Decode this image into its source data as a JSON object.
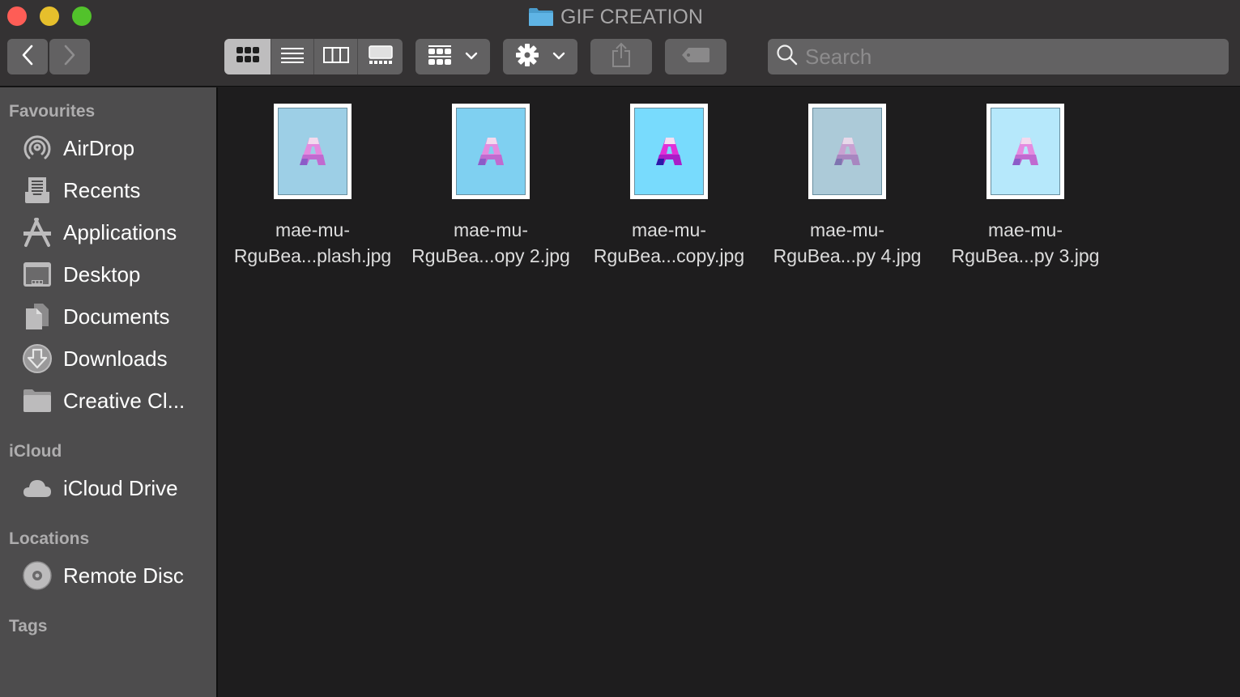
{
  "window": {
    "title": "GIF CREATION",
    "title_icon": "folder-icon",
    "folder_color": "#5fb4e5"
  },
  "toolbar": {
    "back_icon": "chevron-left-icon",
    "forward_icon": "chevron-right-icon",
    "view_modes": [
      {
        "name": "icon-view",
        "icon": "grid-icon",
        "active": true
      },
      {
        "name": "list-view",
        "icon": "list-icon",
        "active": false
      },
      {
        "name": "column-view",
        "icon": "columns-icon",
        "active": false
      },
      {
        "name": "gallery-view",
        "icon": "gallery-icon",
        "active": false
      }
    ],
    "group_icon": "group-icon",
    "action_icon": "gear-icon",
    "share_icon": "share-icon",
    "tag_icon": "tag-icon"
  },
  "search": {
    "placeholder": "Search",
    "value": ""
  },
  "sidebar": {
    "sections": [
      {
        "label": "Favourites",
        "items": [
          {
            "label": "AirDrop",
            "icon": "airdrop-icon"
          },
          {
            "label": "Recents",
            "icon": "recents-icon"
          },
          {
            "label": "Applications",
            "icon": "applications-icon"
          },
          {
            "label": "Desktop",
            "icon": "desktop-icon"
          },
          {
            "label": "Documents",
            "icon": "documents-icon"
          },
          {
            "label": "Downloads",
            "icon": "downloads-icon"
          },
          {
            "label": "Creative Cl...",
            "icon": "folder-icon"
          }
        ]
      },
      {
        "label": "iCloud",
        "items": [
          {
            "label": "iCloud Drive",
            "icon": "cloud-icon"
          }
        ]
      },
      {
        "label": "Locations",
        "items": [
          {
            "label": "Remote Disc",
            "icon": "disc-icon"
          }
        ]
      },
      {
        "label": "Tags",
        "items": []
      }
    ]
  },
  "files": [
    {
      "line1": "mae-mu-",
      "line2": "RguBea...plash.jpg",
      "bg": "#9dcfe6",
      "tint": "normal"
    },
    {
      "line1": "mae-mu-",
      "line2": "RguBea...opy 2.jpg",
      "bg": "#7fd0f1",
      "tint": "normal"
    },
    {
      "line1": "mae-mu-",
      "line2": "RguBea...copy.jpg",
      "bg": "#78dbfd",
      "tint": "saturated"
    },
    {
      "line1": "mae-mu-",
      "line2": "RguBea...py 4.jpg",
      "bg": "#accad8",
      "tint": "muted"
    },
    {
      "line1": "mae-mu-",
      "line2": "RguBea...py 3.jpg",
      "bg": "#b6e8fb",
      "tint": "normal"
    }
  ]
}
